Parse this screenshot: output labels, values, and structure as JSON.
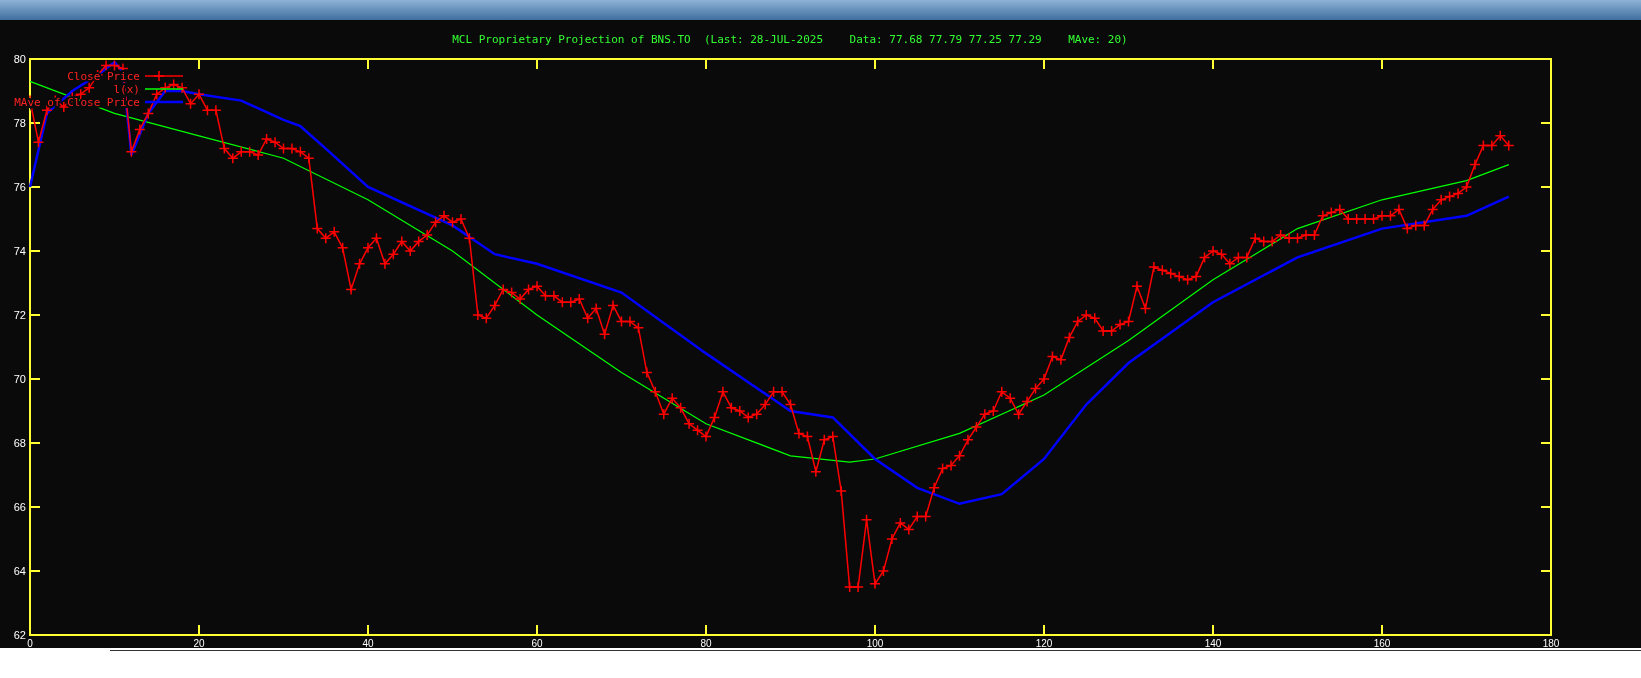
{
  "chart_data": {
    "type": "line",
    "title": "MCL Proprietary Projection of BNS.TO  (Last: 28-JUL-2025    Data: 77.68 77.79 77.25 77.29    MAve: 20)",
    "xlim": [
      0,
      180
    ],
    "ylim": [
      62,
      80
    ],
    "xticks": [
      0,
      20,
      40,
      60,
      80,
      100,
      120,
      140,
      160,
      180
    ],
    "yticks": [
      62,
      64,
      66,
      68,
      70,
      72,
      74,
      76,
      78,
      80
    ],
    "legend": true,
    "series": [
      {
        "name": "Close Price",
        "color": "#ff0000",
        "marker": "+",
        "x": [
          0,
          1,
          2,
          3,
          4,
          5,
          6,
          7,
          8,
          9,
          10,
          11,
          12,
          13,
          14,
          15,
          16,
          17,
          18,
          19,
          20,
          21,
          22,
          23,
          24,
          25,
          26,
          27,
          28,
          29,
          30,
          31,
          32,
          33,
          34,
          35,
          36,
          37,
          38,
          39,
          40,
          41,
          42,
          43,
          44,
          45,
          46,
          47,
          48,
          49,
          50,
          51,
          52,
          53,
          54,
          55,
          56,
          57,
          58,
          59,
          60,
          61,
          62,
          63,
          64,
          65,
          66,
          67,
          68,
          69,
          70,
          71,
          72,
          73,
          74,
          75,
          76,
          77,
          78,
          79,
          80,
          81,
          82,
          83,
          84,
          85,
          86,
          87,
          88,
          89,
          90,
          91,
          92,
          93,
          94,
          95,
          96,
          97,
          98,
          99,
          100,
          101,
          102,
          103,
          104,
          105,
          106,
          107,
          108,
          109,
          110,
          111,
          112,
          113,
          114,
          115,
          116,
          117,
          118,
          119,
          120,
          121,
          122,
          123,
          124,
          125,
          126,
          127,
          128,
          129,
          130,
          131,
          132,
          133,
          134,
          135,
          136,
          137,
          138,
          139,
          140,
          141,
          142,
          143,
          144,
          145,
          146,
          147,
          148,
          149,
          150,
          151,
          152,
          153,
          154,
          155,
          156,
          157,
          158,
          159,
          160,
          161,
          162,
          163,
          164,
          165,
          166,
          167,
          168,
          169,
          170,
          171,
          172,
          173,
          174,
          175
        ],
        "values": [
          78.7,
          77.4,
          78.4,
          78.7,
          78.5,
          78.8,
          78.9,
          79.1,
          79.5,
          79.8,
          79.8,
          79.7,
          77.1,
          77.8,
          78.3,
          78.9,
          79.1,
          79.2,
          79.1,
          78.6,
          78.9,
          78.4,
          78.4,
          77.2,
          76.9,
          77.1,
          77.1,
          77.0,
          77.5,
          77.4,
          77.2,
          77.2,
          77.1,
          76.9,
          74.7,
          74.4,
          74.6,
          74.1,
          72.8,
          73.6,
          74.1,
          74.4,
          73.6,
          73.9,
          74.3,
          74.0,
          74.3,
          74.5,
          74.9,
          75.1,
          74.9,
          75.0,
          74.4,
          72.0,
          71.9,
          72.3,
          72.8,
          72.7,
          72.5,
          72.8,
          72.9,
          72.6,
          72.6,
          72.4,
          72.4,
          72.5,
          71.9,
          72.2,
          71.4,
          72.3,
          71.8,
          71.8,
          71.6,
          70.2,
          69.6,
          68.9,
          69.4,
          69.1,
          68.6,
          68.4,
          68.2,
          68.8,
          69.6,
          69.1,
          69.0,
          68.8,
          68.9,
          69.2,
          69.6,
          69.6,
          69.2,
          68.3,
          68.2,
          67.1,
          68.1,
          68.2,
          66.5,
          63.5,
          63.5,
          65.6,
          63.6,
          64.0,
          65.0,
          65.5,
          65.3,
          65.7,
          65.7,
          66.6,
          67.2,
          67.3,
          67.6,
          68.1,
          68.5,
          68.9,
          69.0,
          69.6,
          69.4,
          68.9,
          69.3,
          69.7,
          70.0,
          70.7,
          70.6,
          71.3,
          71.8,
          72.0,
          71.9,
          71.5,
          71.5,
          71.7,
          71.8,
          72.9,
          72.2,
          73.5,
          73.4,
          73.3,
          73.2,
          73.1,
          73.2,
          73.8,
          74.0,
          73.9,
          73.6,
          73.8,
          73.8,
          74.4,
          74.3,
          74.3,
          74.5,
          74.4,
          74.4,
          74.5,
          74.5,
          75.1,
          75.2,
          75.3,
          75.0,
          75.0,
          75.0,
          75.0,
          75.1,
          75.1,
          75.3,
          74.7,
          74.8,
          74.8,
          75.3,
          75.6,
          75.7,
          75.8,
          76.0,
          76.7,
          77.3,
          77.3,
          77.6,
          77.3
        ]
      },
      {
        "name": "l(x)",
        "color": "#00ff00",
        "x": [
          0,
          10,
          20,
          30,
          40,
          50,
          60,
          70,
          80,
          90,
          97,
          100,
          110,
          120,
          130,
          140,
          150,
          160,
          170,
          175
        ],
        "values": [
          79.3,
          78.3,
          77.6,
          76.9,
          75.6,
          74.0,
          72.0,
          70.2,
          68.6,
          67.6,
          67.4,
          67.5,
          68.3,
          69.5,
          71.2,
          73.1,
          74.7,
          75.6,
          76.2,
          76.7
        ]
      },
      {
        "name": "MAve of Close Price",
        "color": "#0000ff",
        "x": [
          0,
          2,
          5,
          8,
          10,
          11,
          12,
          14,
          16,
          18,
          20,
          25,
          30,
          32,
          35,
          40,
          50,
          55,
          60,
          70,
          80,
          90,
          95,
          100,
          105,
          110,
          115,
          120,
          125,
          130,
          140,
          150,
          160,
          170,
          175
        ],
        "values": [
          76.0,
          78.3,
          79.0,
          79.5,
          79.9,
          79.6,
          77.0,
          78.3,
          79.0,
          79.0,
          78.9,
          78.7,
          78.1,
          77.9,
          77.2,
          76.0,
          74.8,
          73.9,
          73.6,
          72.7,
          70.8,
          69.0,
          68.8,
          67.5,
          66.6,
          66.1,
          66.4,
          67.5,
          69.2,
          70.5,
          72.4,
          73.8,
          74.7,
          75.1,
          75.7
        ]
      }
    ]
  }
}
